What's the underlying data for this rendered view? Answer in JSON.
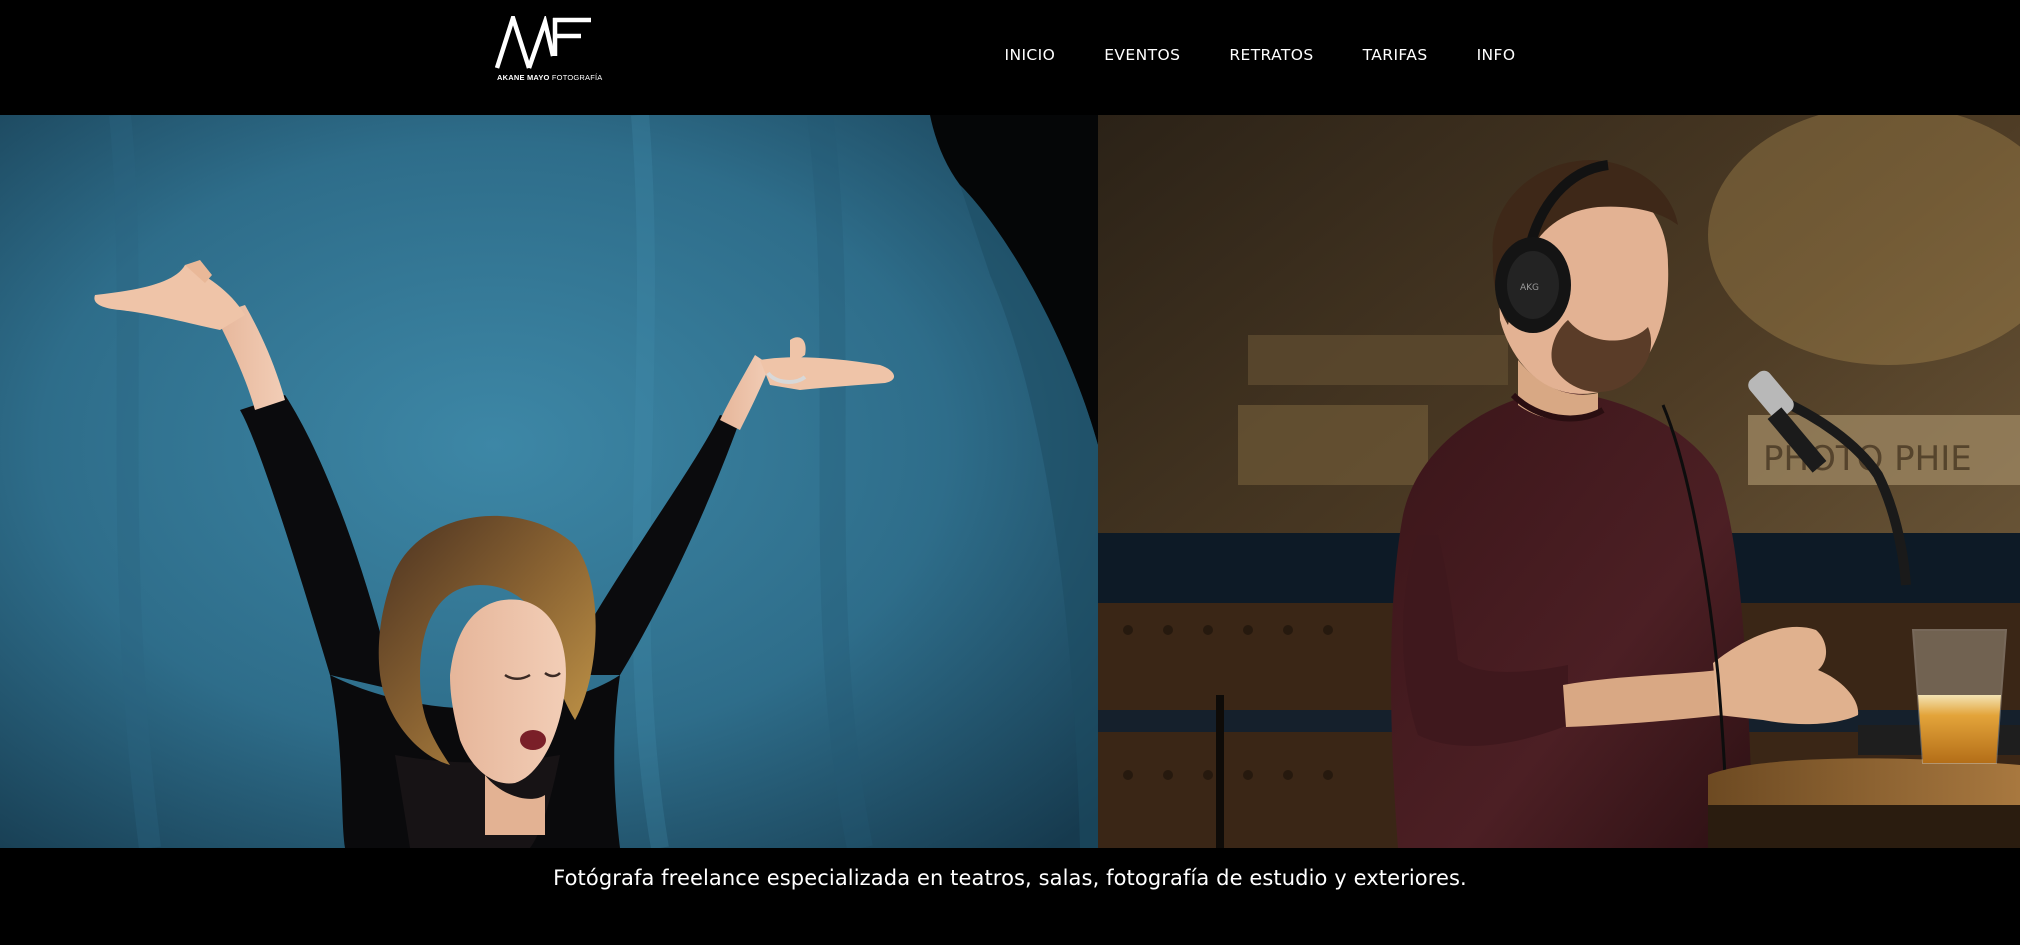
{
  "brand": {
    "logo_letters": "AMF",
    "logo_name": "AKANE MAYO",
    "logo_subtitle": "FOTOGRAFÍA"
  },
  "nav": {
    "items": [
      {
        "label": "INICIO"
      },
      {
        "label": "EVENTOS"
      },
      {
        "label": "RETRATOS"
      },
      {
        "label": "TARIFAS"
      },
      {
        "label": "INFO"
      }
    ]
  },
  "hero": {
    "left_image": "woman-arms-raised-blue-backdrop",
    "right_image": "man-headphones-microphone-bar"
  },
  "tagline": "Fotógrafa freelance especializada en teatros, salas, fotografía de estudio y exteriores.",
  "colors": {
    "background": "#000000",
    "text": "#ffffff",
    "backdrop_blue": "#2f6f8c",
    "sweater_maroon": "#4a1e22"
  }
}
